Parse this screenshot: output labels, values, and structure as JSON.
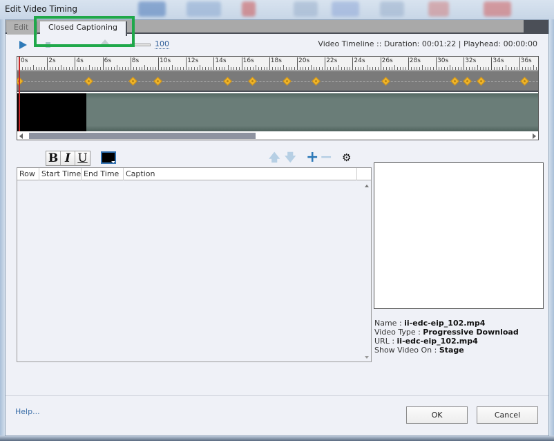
{
  "window": {
    "title": "Edit Video Timing"
  },
  "tabs": [
    {
      "label": "Edit",
      "active": false
    },
    {
      "label": "Closed Captioning",
      "active": true
    }
  ],
  "controls": {
    "play_icon": "play-icon",
    "stop_icon": "stop-icon",
    "volume_value": "100",
    "timeline_info": "Video Timeline :: Duration: 00:01:22  |  Playhead: 00:00:00"
  },
  "timeline": {
    "ruler_labels": [
      "0s",
      "2s",
      "4s",
      "6s",
      "8s",
      "10s",
      "12s",
      "14s",
      "16s",
      "18s",
      "20s",
      "22s",
      "24s",
      "26s",
      "28s",
      "30s",
      "32s",
      "34s",
      "36s"
    ],
    "cue_markers_seconds": [
      0,
      5.0,
      8.2,
      10.0,
      15.0,
      16.8,
      19.3,
      21.4,
      26.4,
      31.4,
      32.3,
      33.3,
      36.4
    ],
    "playhead_seconds": 0
  },
  "formatting": {
    "bold": "B",
    "italic": "I",
    "underline": "U",
    "color_icon": "font-color-picker-icon",
    "text_color": "#000000"
  },
  "caption_toolbar": {
    "move_up_icon": "arrow-up-icon",
    "move_down_icon": "arrow-down-icon",
    "add_icon": "plus-icon",
    "remove_icon": "minus-icon",
    "settings_icon": "gear-icon"
  },
  "caption_grid": {
    "columns": [
      "Row",
      "Start Time",
      "End Time",
      "Caption"
    ],
    "rows": []
  },
  "video_properties": {
    "name_label": "Name : ",
    "name_value": "ii-edc-eip_102.mp4",
    "type_label": "Video Type : ",
    "type_value": "Progressive Download",
    "url_label": "URL : ",
    "url_value": "ii-edc-eip_102.mp4",
    "show_label": "Show Video On : ",
    "show_value": "Stage"
  },
  "footer": {
    "help_link": "Help...",
    "ok_label": "OK",
    "cancel_label": "Cancel"
  },
  "colors": {
    "highlight": "#1fa84a",
    "accent": "#2e7ab8",
    "marker": "#f0b52a",
    "playhead": "#c62828"
  }
}
